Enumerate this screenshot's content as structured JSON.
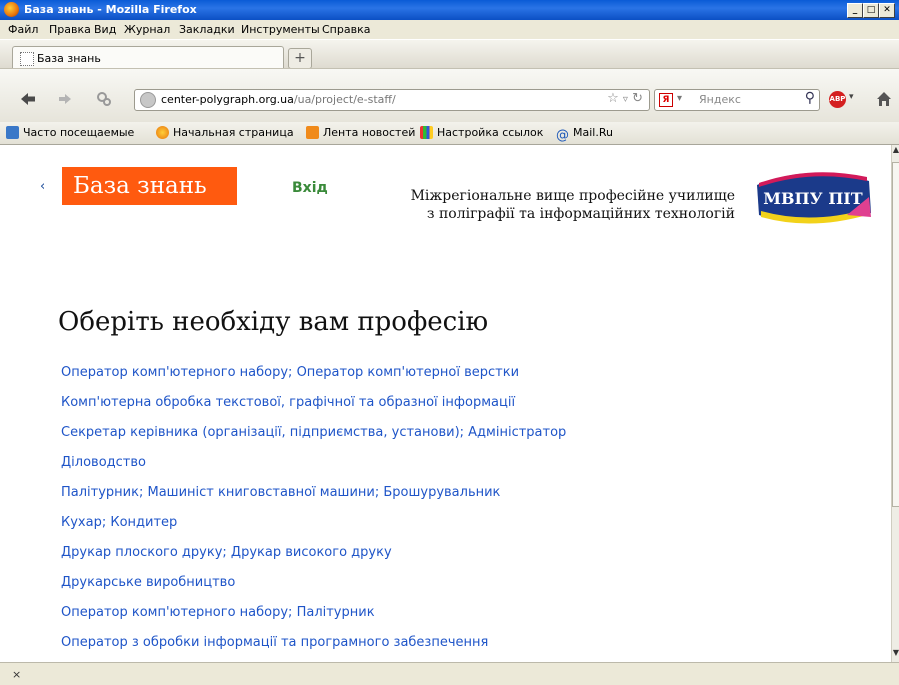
{
  "window": {
    "title": "База знань - Mozilla Firefox",
    "buttons": [
      "_",
      "□",
      "✕"
    ]
  },
  "menu": [
    "Файл",
    "Правка",
    "Вид",
    "Журнал",
    "Закладки",
    "Инструменты",
    "Справка"
  ],
  "tab": {
    "label": "База знань",
    "new_tab": "+"
  },
  "nav": {
    "url_host": "center-polygraph.org.ua",
    "url_path": "/ua/project/e-staff/",
    "search_engine_icon": "Я",
    "search_placeholder": "Яндекс",
    "abp_label": "ABP"
  },
  "bookmarks": [
    "Часто посещаемые",
    "Начальная страница",
    "Лента новостей",
    "Настройка ссылок",
    "Mail.Ru"
  ],
  "page": {
    "back": "‹",
    "logo_text": "База знань",
    "login": "Вхід",
    "school_line1": "Міжрегіональне вище професійне училище",
    "school_line2": "з поліграфії та інформаційних технологій",
    "emblem_text": "МВПУ ПІТ",
    "heading": "Оберіть необхіду вам професію",
    "professions": [
      "Оператор комп'ютерного набору; Оператор комп'ютерної верстки",
      "Комп'ютерна обробка текстової, графічної та образної інформації",
      "Секретар керівника (організації, підприємства, установи); Адміністратор",
      "Діловодство",
      "Палітурник; Машиніст книговставної машини; Брошурувальник",
      "Кухар; Кондитер",
      "Друкар плоского друку; Друкар високого друку",
      "Друкарське виробництво",
      "Оператор комп'ютерного набору; Палітурник",
      "Оператор з обробки інформації та програмного забезпечення"
    ]
  },
  "status": {
    "close": "×"
  },
  "colors": {
    "logo_bg": "#ff5a0f",
    "link": "#1f55c8",
    "login": "#3a8a3a"
  }
}
